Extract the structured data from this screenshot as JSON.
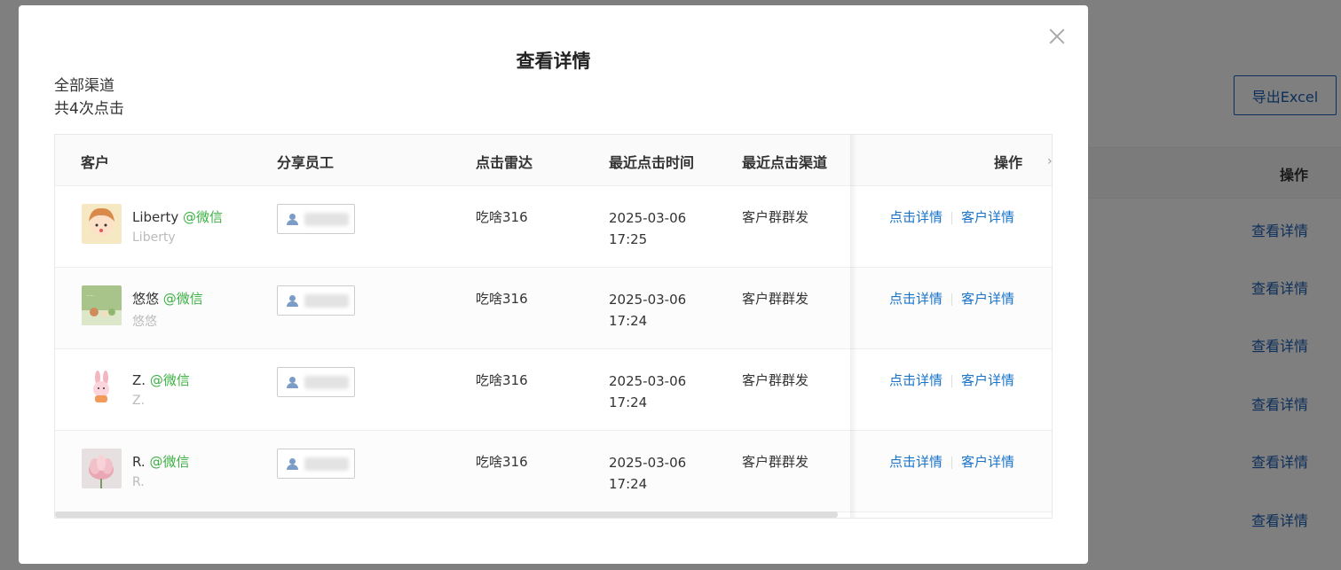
{
  "background": {
    "export_label": "导出Excel",
    "op_header": "操作",
    "links": [
      "查看详情",
      "查看详情",
      "查看详情",
      "查看详情",
      "查看详情",
      "查看详情"
    ]
  },
  "modal": {
    "title": "查看详情",
    "channel": "全部渠道",
    "total": "共4次点击",
    "columns": [
      "客户",
      "分享员工",
      "点击雷达",
      "最近点击时间",
      "最近点击渠道",
      "操作"
    ],
    "rows": [
      {
        "name": "Liberty",
        "tag": "@微信",
        "sub": "Liberty",
        "radar": "吃啥316",
        "date": "2025-03-06",
        "time": "17:25",
        "channel": "客户群群发",
        "op1": "点击详情",
        "op2": "客户详情"
      },
      {
        "name": "悠悠",
        "tag": "@微信",
        "sub": "悠悠",
        "radar": "吃啥316",
        "date": "2025-03-06",
        "time": "17:24",
        "channel": "客户群群发",
        "op1": "点击详情",
        "op2": "客户详情"
      },
      {
        "name": "Z.",
        "tag": "@微信",
        "sub": "Z.",
        "radar": "吃啥316",
        "date": "2025-03-06",
        "time": "17:24",
        "channel": "客户群群发",
        "op1": "点击详情",
        "op2": "客户详情"
      },
      {
        "name": "R.",
        "tag": "@微信",
        "sub": "R.",
        "radar": "吃啥316",
        "date": "2025-03-06",
        "time": "17:24",
        "channel": "客户群群发",
        "op1": "点击详情",
        "op2": "客户详情"
      }
    ]
  },
  "colors": {
    "accent": "#1a73c8",
    "wechat_tag": "#3cb043"
  }
}
